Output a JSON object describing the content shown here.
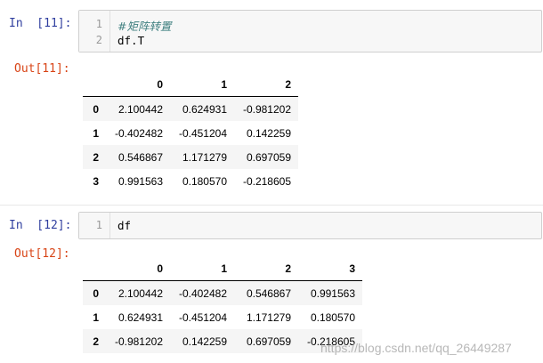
{
  "cell1": {
    "in_prompt": "In  [11]:",
    "line_numbers": [
      "1",
      "2"
    ],
    "code_lines": [
      "#矩阵转置",
      "df.T"
    ],
    "out_prompt": "Out[11]:",
    "table": {
      "columns": [
        "",
        "0",
        "1",
        "2"
      ],
      "rows": [
        {
          "index": "0",
          "values": [
            "2.100442",
            "0.624931",
            "-0.981202"
          ]
        },
        {
          "index": "1",
          "values": [
            "-0.402482",
            "-0.451204",
            "0.142259"
          ]
        },
        {
          "index": "2",
          "values": [
            "0.546867",
            "1.171279",
            "0.697059"
          ]
        },
        {
          "index": "3",
          "values": [
            "0.991563",
            "0.180570",
            "-0.218605"
          ]
        }
      ]
    }
  },
  "cell2": {
    "in_prompt": "In  [12]:",
    "line_numbers": [
      "1"
    ],
    "code_lines": [
      "df"
    ],
    "out_prompt": "Out[12]:",
    "table": {
      "columns": [
        "",
        "0",
        "1",
        "2",
        "3"
      ],
      "rows": [
        {
          "index": "0",
          "values": [
            "2.100442",
            "-0.402482",
            "0.546867",
            "0.991563"
          ]
        },
        {
          "index": "1",
          "values": [
            "0.624931",
            "-0.451204",
            "1.171279",
            "0.180570"
          ]
        },
        {
          "index": "2",
          "values": [
            "-0.981202",
            "0.142259",
            "0.697059",
            "-0.218605"
          ]
        }
      ]
    }
  },
  "watermark": "https://blog.csdn.net/qq_26449287",
  "colors": {
    "in_prompt": "#303f9f",
    "out_prompt": "#d84315",
    "comment": "#408080"
  }
}
